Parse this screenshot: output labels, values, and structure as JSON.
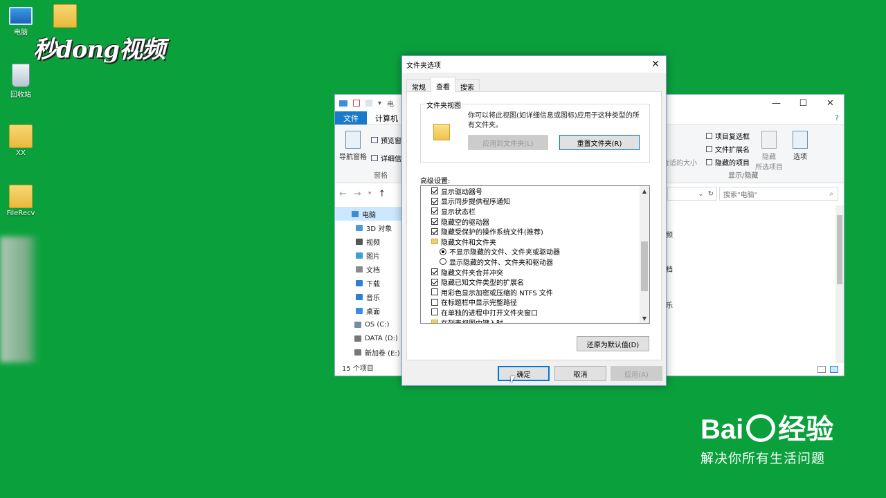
{
  "desktop": {
    "icons": [
      {
        "label": "电脑"
      },
      {
        "label": "回收站"
      },
      {
        "label": "XX"
      },
      {
        "label": "FileRecv"
      }
    ],
    "watermark_tl": "秒dong视频",
    "baidu_logo_left": "Bai",
    "baidu_logo_right": "经验",
    "baidu_slogan": "解决你所有生活问题"
  },
  "explorer": {
    "title_fragment": "电",
    "tabs": {
      "file": "文件",
      "computer": "计算机"
    },
    "ribbon": {
      "nav_pane": "导航窗格",
      "preview_pane": "预览窗",
      "details_pane": "详细信",
      "pane_group": "窗格",
      "size_fragment": "合适的大小",
      "item_checkbox": "项目复选框",
      "file_ext": "文件扩展名",
      "hidden_items": "隐藏的项目",
      "hide_selected_1": "隐藏",
      "hide_selected_2": "所选项目",
      "options": "选项",
      "show_hide_group": "显示/隐藏"
    },
    "search_placeholder": "搜索\"电脑\"",
    "nav": [
      {
        "label": "电脑",
        "color": "#3f8ad8"
      },
      {
        "label": "3D 对象",
        "color": "#4a9ad6"
      },
      {
        "label": "视频",
        "color": "#555555"
      },
      {
        "label": "图片",
        "color": "#3aa0d8"
      },
      {
        "label": "文档",
        "color": "#8a8a8a"
      },
      {
        "label": "下载",
        "color": "#2f7fd0"
      },
      {
        "label": "音乐",
        "color": "#2f7fd0"
      },
      {
        "label": "桌面",
        "color": "#3a8ee0"
      },
      {
        "label": "OS (C:)",
        "color": "#6f8faa"
      },
      {
        "label": "DATA (D:)",
        "color": "#777777"
      },
      {
        "label": "新加卷 (E:)",
        "color": "#777777"
      }
    ],
    "right_col": [
      "频",
      "档",
      "乐"
    ],
    "status": "15 个项目"
  },
  "dialog": {
    "title": "文件夹选项",
    "tabs": [
      "常规",
      "查看",
      "搜索"
    ],
    "folder_views_legend": "文件夹视图",
    "folder_views_desc": "你可以将此视图(如详细信息或图标)应用于这种类型的所有文件夹。",
    "apply_to_folders": "应用到文件夹(L)",
    "reset_folders": "重置文件夹(R)",
    "advanced_label": "高级设置:",
    "settings": [
      {
        "type": "check",
        "on": true,
        "label": "显示驱动器号"
      },
      {
        "type": "check",
        "on": true,
        "label": "显示同步提供程序通知"
      },
      {
        "type": "check",
        "on": true,
        "label": "显示状态栏"
      },
      {
        "type": "check",
        "on": true,
        "label": "隐藏空的驱动器"
      },
      {
        "type": "check",
        "on": true,
        "label": "隐藏受保护的操作系统文件(推荐)"
      },
      {
        "type": "folder",
        "label": "隐藏文件和文件夹"
      },
      {
        "type": "radio",
        "on": true,
        "label": "不显示隐藏的文件、文件夹或驱动器"
      },
      {
        "type": "radio",
        "on": false,
        "label": "显示隐藏的文件、文件夹和驱动器"
      },
      {
        "type": "check",
        "on": true,
        "label": "隐藏文件夹合并冲突"
      },
      {
        "type": "check",
        "on": true,
        "label": "隐藏已知文件类型的扩展名"
      },
      {
        "type": "check",
        "on": false,
        "label": "用彩色显示加密或压缩的 NTFS 文件"
      },
      {
        "type": "check",
        "on": false,
        "label": "在标题栏中显示完整路径"
      },
      {
        "type": "check",
        "on": false,
        "label": "在单独的进程中打开文件夹窗口"
      },
      {
        "type": "folder",
        "label": "在列表视图中键入时"
      }
    ],
    "restore_defaults": "还原为默认值(D)",
    "ok": "确定",
    "cancel": "取消",
    "apply": "应用(A)"
  }
}
